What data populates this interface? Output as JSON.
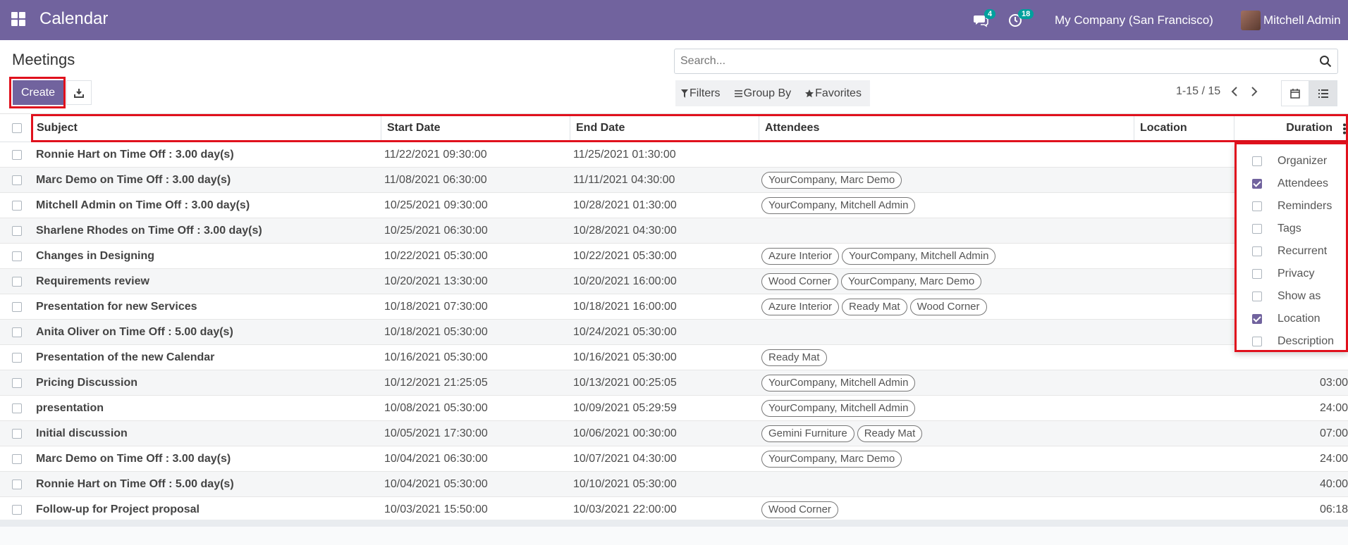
{
  "navbar": {
    "app_title": "Calendar",
    "chat_count": "4",
    "activity_count": "18",
    "company": "My Company (San Francisco)",
    "user": "Mitchell Admin",
    "accent_color": "#71639e"
  },
  "control": {
    "breadcrumb": "Meetings",
    "create_label": "Create",
    "search_placeholder": "Search...",
    "filters_label": "Filters",
    "groupby_label": "Group By",
    "favorites_label": "Favorites",
    "pager": "1-15 / 15"
  },
  "columns": {
    "subject": "Subject",
    "start": "Start Date",
    "end": "End Date",
    "attendees": "Attendees",
    "location": "Location",
    "duration": "Duration"
  },
  "rows": [
    {
      "subject": "Ronnie Hart on Time Off : 3.00 day(s)",
      "start": "11/22/2021 09:30:00",
      "end": "11/25/2021 01:30:00",
      "attendees": [],
      "duration": ""
    },
    {
      "subject": "Marc Demo on Time Off : 3.00 day(s)",
      "start": "11/08/2021 06:30:00",
      "end": "11/11/2021 04:30:00",
      "attendees": [
        "YourCompany, Marc Demo"
      ],
      "duration": ""
    },
    {
      "subject": "Mitchell Admin on Time Off : 3.00 day(s)",
      "start": "10/25/2021 09:30:00",
      "end": "10/28/2021 01:30:00",
      "attendees": [
        "YourCompany, Mitchell Admin"
      ],
      "duration": ""
    },
    {
      "subject": "Sharlene Rhodes on Time Off : 3.00 day(s)",
      "start": "10/25/2021 06:30:00",
      "end": "10/28/2021 04:30:00",
      "attendees": [],
      "duration": ""
    },
    {
      "subject": "Changes in Designing",
      "start": "10/22/2021 05:30:00",
      "end": "10/22/2021 05:30:00",
      "attendees": [
        "Azure Interior",
        "YourCompany, Mitchell Admin"
      ],
      "duration": ""
    },
    {
      "subject": "Requirements review",
      "start": "10/20/2021 13:30:00",
      "end": "10/20/2021 16:00:00",
      "attendees": [
        "Wood Corner",
        "YourCompany, Marc Demo"
      ],
      "duration": ""
    },
    {
      "subject": "Presentation for new Services",
      "start": "10/18/2021 07:30:00",
      "end": "10/18/2021 16:00:00",
      "attendees": [
        "Azure Interior",
        "Ready Mat",
        "Wood Corner"
      ],
      "duration": ""
    },
    {
      "subject": "Anita Oliver on Time Off : 5.00 day(s)",
      "start": "10/18/2021 05:30:00",
      "end": "10/24/2021 05:30:00",
      "attendees": [],
      "duration": ""
    },
    {
      "subject": "Presentation of the new Calendar",
      "start": "10/16/2021 05:30:00",
      "end": "10/16/2021 05:30:00",
      "attendees": [
        "Ready Mat"
      ],
      "duration": ""
    },
    {
      "subject": "Pricing Discussion",
      "start": "10/12/2021 21:25:05",
      "end": "10/13/2021 00:25:05",
      "attendees": [
        "YourCompany, Mitchell Admin"
      ],
      "duration": "03:00"
    },
    {
      "subject": "presentation",
      "start": "10/08/2021 05:30:00",
      "end": "10/09/2021 05:29:59",
      "attendees": [
        "YourCompany, Mitchell Admin"
      ],
      "duration": "24:00"
    },
    {
      "subject": "Initial discussion",
      "start": "10/05/2021 17:30:00",
      "end": "10/06/2021 00:30:00",
      "attendees": [
        "Gemini Furniture",
        "Ready Mat"
      ],
      "duration": "07:00"
    },
    {
      "subject": "Marc Demo on Time Off : 3.00 day(s)",
      "start": "10/04/2021 06:30:00",
      "end": "10/07/2021 04:30:00",
      "attendees": [
        "YourCompany, Marc Demo"
      ],
      "duration": "24:00"
    },
    {
      "subject": "Ronnie Hart on Time Off : 5.00 day(s)",
      "start": "10/04/2021 05:30:00",
      "end": "10/10/2021 05:30:00",
      "attendees": [],
      "duration": "40:00"
    },
    {
      "subject": "Follow-up for Project proposal",
      "start": "10/03/2021 15:50:00",
      "end": "10/03/2021 22:00:00",
      "attendees": [
        "Wood Corner"
      ],
      "duration": "06:18"
    }
  ],
  "optional_columns": [
    {
      "label": "Organizer",
      "checked": false
    },
    {
      "label": "Attendees",
      "checked": true
    },
    {
      "label": "Reminders",
      "checked": false
    },
    {
      "label": "Tags",
      "checked": false
    },
    {
      "label": "Recurrent",
      "checked": false
    },
    {
      "label": "Privacy",
      "checked": false
    },
    {
      "label": "Show as",
      "checked": false
    },
    {
      "label": "Location",
      "checked": true
    },
    {
      "label": "Description",
      "checked": false
    }
  ]
}
